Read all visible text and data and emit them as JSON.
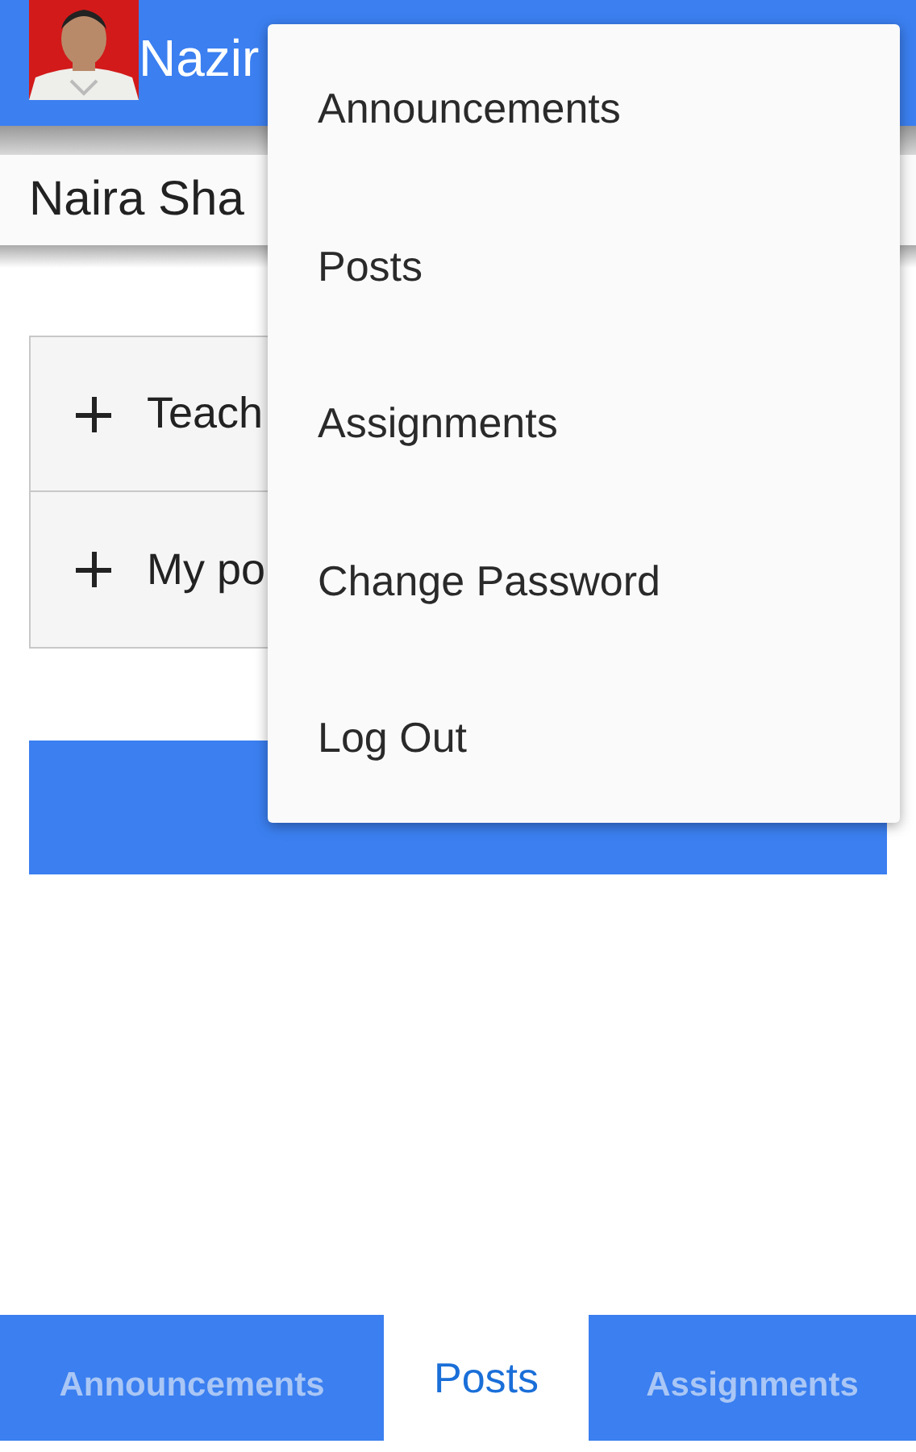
{
  "header": {
    "title": "Nazir"
  },
  "subheader": {
    "name": "Naira Sha"
  },
  "sections": [
    {
      "label": "Teach",
      "expanded": false
    },
    {
      "label": "My po",
      "expanded": false
    }
  ],
  "menu": {
    "items": [
      {
        "label": "Announcements"
      },
      {
        "label": "Posts"
      },
      {
        "label": "Assignments"
      },
      {
        "label": "Change Password"
      },
      {
        "label": "Log Out"
      }
    ]
  },
  "tabs": [
    {
      "label": "Announcements",
      "selected": false
    },
    {
      "label": "Posts",
      "selected": true
    },
    {
      "label": "Assignments",
      "selected": false
    }
  ]
}
